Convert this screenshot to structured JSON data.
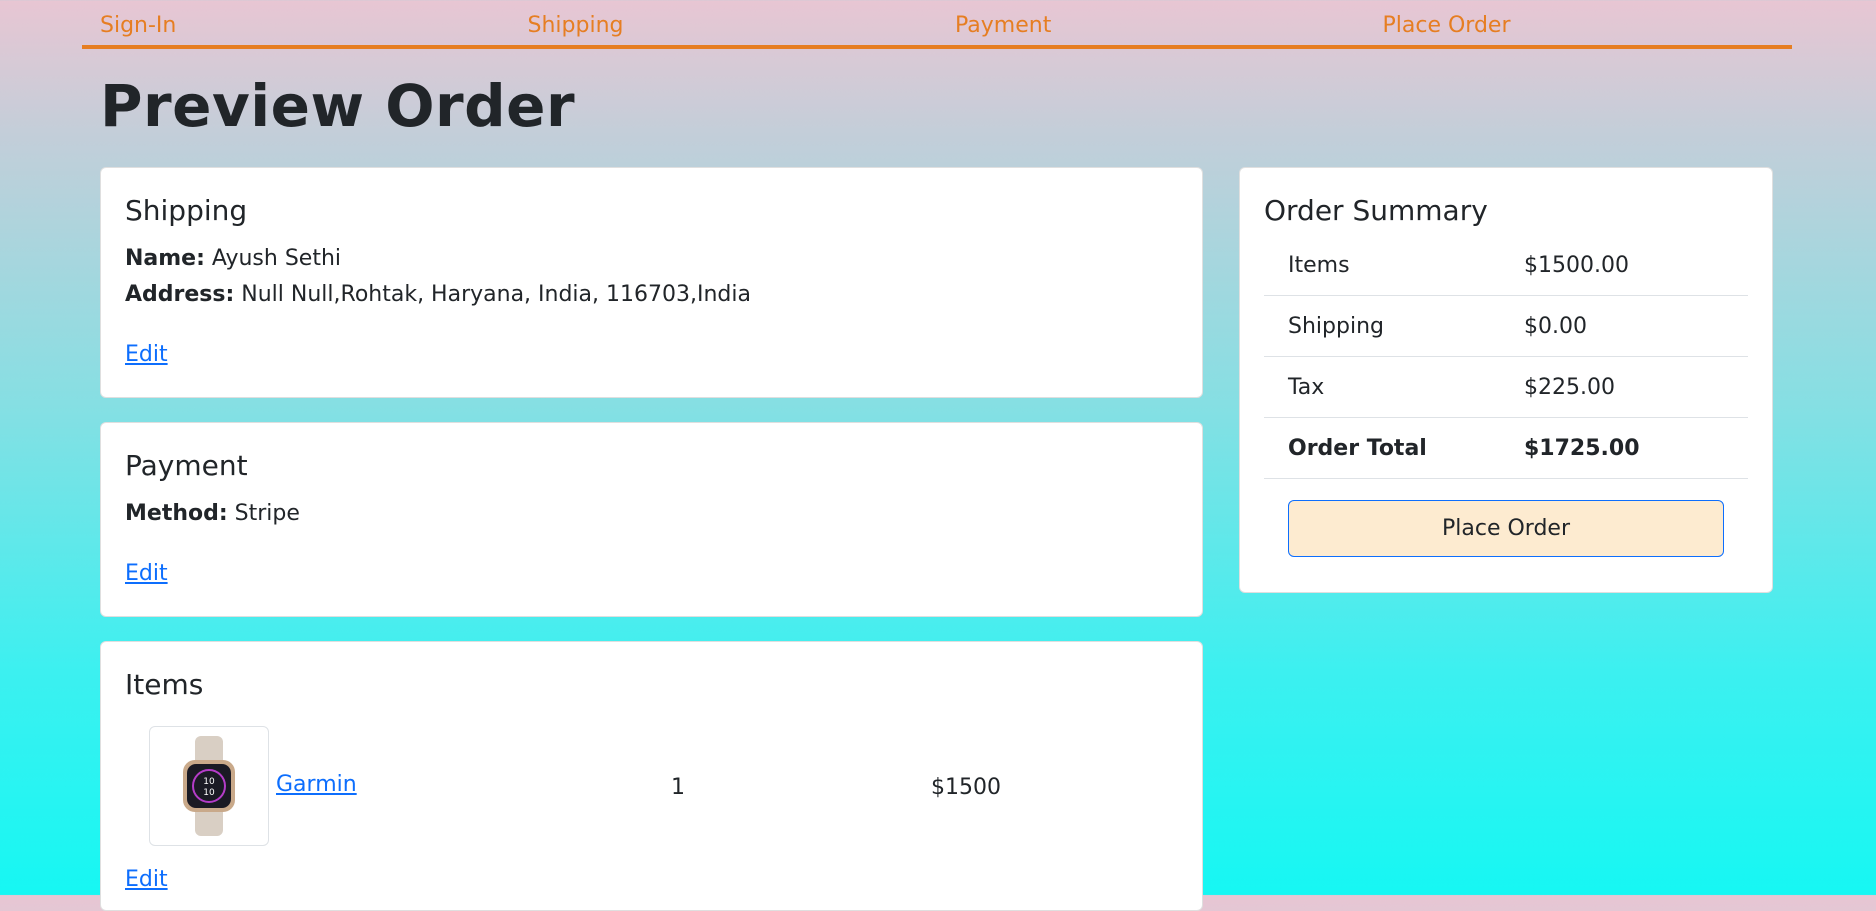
{
  "steps": [
    "Sign-In",
    "Shipping",
    "Payment",
    "Place Order"
  ],
  "page_title": "Preview Order",
  "shipping": {
    "heading": "Shipping",
    "name_label": "Name:",
    "name_value": "Ayush Sethi",
    "address_label": "Address:",
    "address_value": "Null Null,Rohtak, Haryana, India, 116703,India",
    "edit": "Edit"
  },
  "payment": {
    "heading": "Payment",
    "method_label": "Method:",
    "method_value": "Stripe",
    "edit": "Edit"
  },
  "items": {
    "heading": "Items",
    "list": [
      {
        "name": "Garmin",
        "quantity": "1",
        "price": "$1500",
        "icon": "smartwatch-image"
      }
    ],
    "edit": "Edit"
  },
  "summary": {
    "heading": "Order Summary",
    "rows": [
      {
        "label": "Items",
        "value": "$1500.00"
      },
      {
        "label": "Shipping",
        "value": "$0.00"
      },
      {
        "label": "Tax",
        "value": "$225.00"
      },
      {
        "label": "Order Total",
        "value": "$1725.00"
      }
    ],
    "place_order": "Place Order"
  },
  "colors": {
    "accent": "#e67e22",
    "link": "#0d6efd",
    "button_bg": "#fdebd0"
  }
}
